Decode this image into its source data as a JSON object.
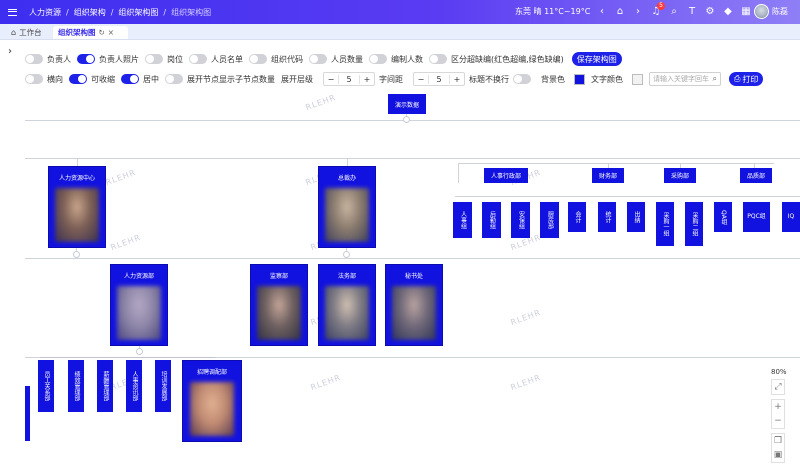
{
  "header": {
    "breadcrumb": [
      "人力资源",
      "组织架构",
      "组织架构图",
      "组织架构图"
    ],
    "weather": "东莞 晴 11°C~19°C",
    "notification_count": "5",
    "username": "陈磊"
  },
  "tabs": {
    "home_label": "工作台",
    "active_label": "组织架构图"
  },
  "controls": {
    "row1": [
      {
        "label": "负责人",
        "on": false
      },
      {
        "label": "负责人照片",
        "on": true
      },
      {
        "label": "岗位",
        "on": false
      },
      {
        "label": "人员名单",
        "on": false
      },
      {
        "label": "组织代码",
        "on": false
      },
      {
        "label": "人员数量",
        "on": false
      },
      {
        "label": "编制人数",
        "on": false
      },
      {
        "label": "区分超缺编(红色超编,绿色缺编)",
        "on": false
      }
    ],
    "save_label": "保存架构图",
    "horizontal_label": "横向",
    "collapsible_label": "可收缩",
    "center_label": "居中",
    "show_children_count_label": "展开节点显示子节点数量",
    "expand_level_label": "展开层级",
    "expand_level_value": "5",
    "char_spacing_label": "字间距",
    "char_spacing_value": "5",
    "no_wrap_label": "标题不换行",
    "bg_color_label": "背景色",
    "bg_color": "#1212e0",
    "text_color_label": "文字颜色",
    "text_color": "#f2f2f2",
    "search_placeholder": "请输入关键字回车",
    "print_label": "打印"
  },
  "chart": {
    "root": "演示数据",
    "watermark": "RLEHR",
    "nodes_with_photo": [
      "人力资源中心",
      "总裁办",
      "人力资源部",
      "监察部",
      "法务部",
      "秘书处",
      "招聘调配部"
    ],
    "headers": [
      "人事行政部",
      "财务部",
      "采购部",
      "品质部"
    ],
    "vertical_units": [
      "人事组",
      "后勤组",
      "安保组",
      "厨房部",
      "会计",
      "统计",
      "出纳",
      "采购一组",
      "采购二组",
      "QA组",
      "PQC组",
      "IQ"
    ],
    "hr_units": [
      "员工关系部",
      "绩效管理部",
      "薪酬管理部",
      "人事资讯部",
      "培训发展部"
    ]
  },
  "zoom": {
    "level": "80%",
    "plus": "+",
    "minus": "−",
    "fit": "⤢"
  }
}
